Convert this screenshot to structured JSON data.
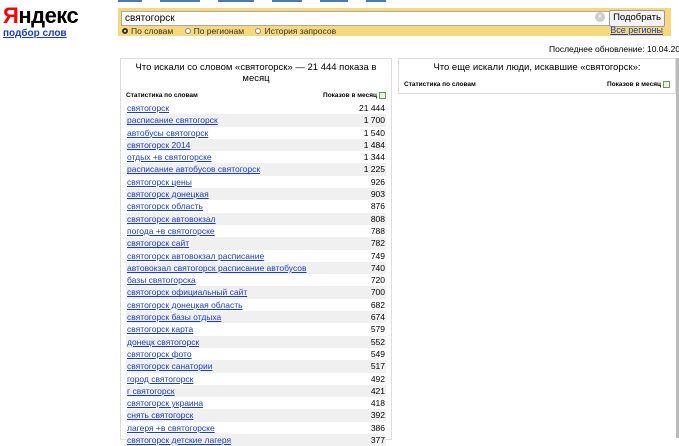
{
  "logo": {
    "text_first": "Я",
    "text_rest": "ндекс"
  },
  "subtitle": "подбор слов",
  "search": {
    "value": "святогорск",
    "button": "Подобрать"
  },
  "modes": [
    {
      "label": "По словам",
      "selected": true
    },
    {
      "label": "По регионам",
      "selected": false
    },
    {
      "label": "История запросов",
      "selected": false
    }
  ],
  "all_regions": "Все регионы",
  "updated": "Последнее обновление: 10.04.2014",
  "left_panel": {
    "title": "Что искали со словом «святогорск» — 21 444 показа в месяц",
    "col_query": "Статистика по словам",
    "col_count": "Показов в месяц",
    "rows": [
      {
        "q": "святогорск",
        "c": "21 444"
      },
      {
        "q": "расписание святогорск",
        "c": "1 700"
      },
      {
        "q": "автобусы святогорск",
        "c": "1 540"
      },
      {
        "q": "святогорск 2014",
        "c": "1 484"
      },
      {
        "q": "отдых +в святогорске",
        "c": "1 344"
      },
      {
        "q": "расписание автобусов святогорск",
        "c": "1 225"
      },
      {
        "q": "святогорск цены",
        "c": "926"
      },
      {
        "q": "святогорск донецкая",
        "c": "903"
      },
      {
        "q": "святогорск область",
        "c": "876"
      },
      {
        "q": "святогорск автовокзал",
        "c": "808"
      },
      {
        "q": "погода +в святогорске",
        "c": "788"
      },
      {
        "q": "святогорск сайт",
        "c": "782"
      },
      {
        "q": "святогорск автовокзал расписание",
        "c": "749"
      },
      {
        "q": "автовокзал святогорск расписание автобусов",
        "c": "740"
      },
      {
        "q": "базы святогорска",
        "c": "720"
      },
      {
        "q": "святогорск официальный сайт",
        "c": "700"
      },
      {
        "q": "святогорск донецкая область",
        "c": "682"
      },
      {
        "q": "святогорск базы отдыха",
        "c": "674"
      },
      {
        "q": "святогорск карта",
        "c": "579"
      },
      {
        "q": "донецк святогорск",
        "c": "552"
      },
      {
        "q": "святогорск фото",
        "c": "549"
      },
      {
        "q": "святогорск санатории",
        "c": "517"
      },
      {
        "q": "город святогорск",
        "c": "492"
      },
      {
        "q": "г святогорск",
        "c": "421"
      },
      {
        "q": "святогорск украина",
        "c": "418"
      },
      {
        "q": "снять святогорск",
        "c": "392"
      },
      {
        "q": "лагеря +в святогорске",
        "c": "386"
      },
      {
        "q": "святогорск детские лагеря",
        "c": "377"
      }
    ]
  },
  "right_panel": {
    "title": "Что еще искали люди, искавшие «святогорск»:",
    "col_query": "Статистика по словам",
    "col_count": "Показов в месяц"
  }
}
